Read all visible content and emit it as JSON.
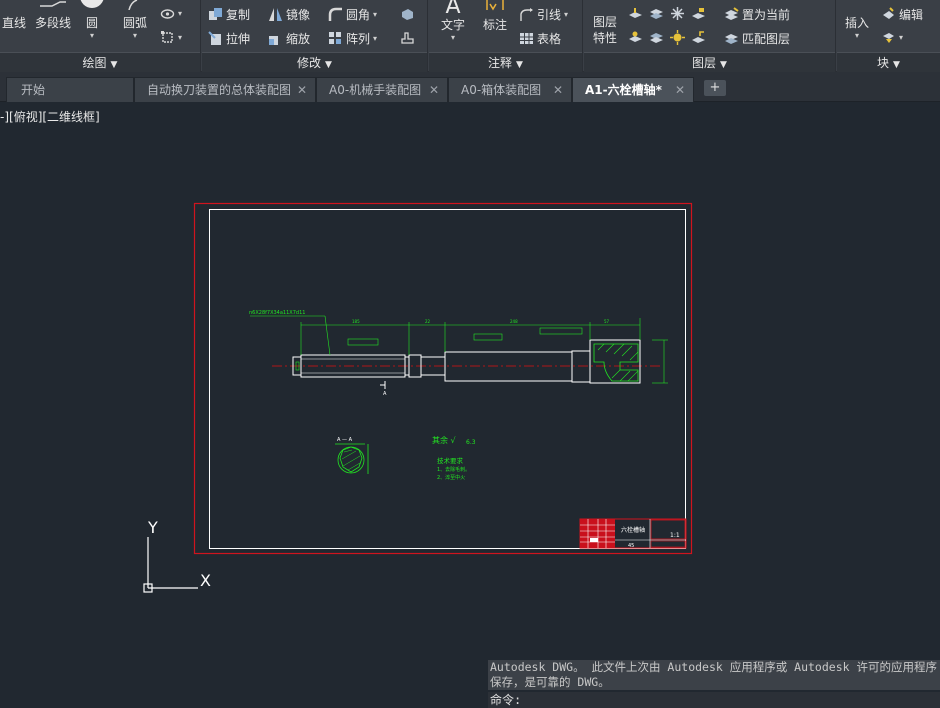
{
  "ribbon": {
    "draw": {
      "title": "绘图",
      "line": "直线",
      "polyline": "多段线",
      "circle": "圆",
      "arc": "圆弧"
    },
    "modify": {
      "title": "修改",
      "copy": "复制",
      "mirror": "镜像",
      "fillet": "圆角",
      "stretch": "拉伸",
      "scale": "缩放",
      "array": "阵列"
    },
    "annotation": {
      "title": "注释",
      "text": "文字",
      "dimension": "标注",
      "leader": "引线",
      "table": "表格"
    },
    "layers": {
      "title": "图层",
      "layer_props_line1": "图层",
      "layer_props_line2": "特性",
      "set_current": "置为当前",
      "match_layer": "匹配图层"
    },
    "block": {
      "title": "块",
      "insert": "插入",
      "edit": "编辑"
    }
  },
  "tabs": [
    {
      "label": "开始",
      "active": false,
      "closable": false
    },
    {
      "label": "自动换刀装置的总体装配图",
      "active": false,
      "closable": true
    },
    {
      "label": "A0-机械手装配图",
      "active": false,
      "closable": true
    },
    {
      "label": "A0-箱体装配图",
      "active": false,
      "closable": true
    },
    {
      "label": "A1-六栓槽轴*",
      "active": true,
      "closable": true
    }
  ],
  "tab_close_glyph": "✕",
  "tab_add_glyph": "+",
  "viewport": {
    "label": "-][俯视][二维线框]"
  },
  "ucs": {
    "x_label": "X",
    "y_label": "Y"
  },
  "drawing_sheet": {
    "shaft_spec": "n6X28f7X34a11X7d11",
    "section_label": "A — A",
    "section_marker": "A",
    "roughness_note": "其余 √",
    "roughness_value": "6.3",
    "tech_req_title": "技术要求",
    "tech_req_1": "1、去除毛刺。",
    "tech_req_2": "2、淬至中火",
    "title_block_name": "六栓槽轴",
    "title_block_material": "45",
    "title_block_scale": "1:1"
  },
  "command": {
    "history_line1": "Autodesk DWG。  此文件上次由 Autodesk 应用程序或 Autodesk 许可的应用程序",
    "history_line2": "保存，是可靠的 DWG。",
    "prompt": "命令:"
  },
  "colors": {
    "canvas": "#212830",
    "ribbon": "#3a3f46",
    "sheet_border": "#d0141e",
    "inner_frame": "#ffffff",
    "dimension": "#22e622",
    "centerline": "#e01010",
    "shaft": "#ffffff"
  }
}
